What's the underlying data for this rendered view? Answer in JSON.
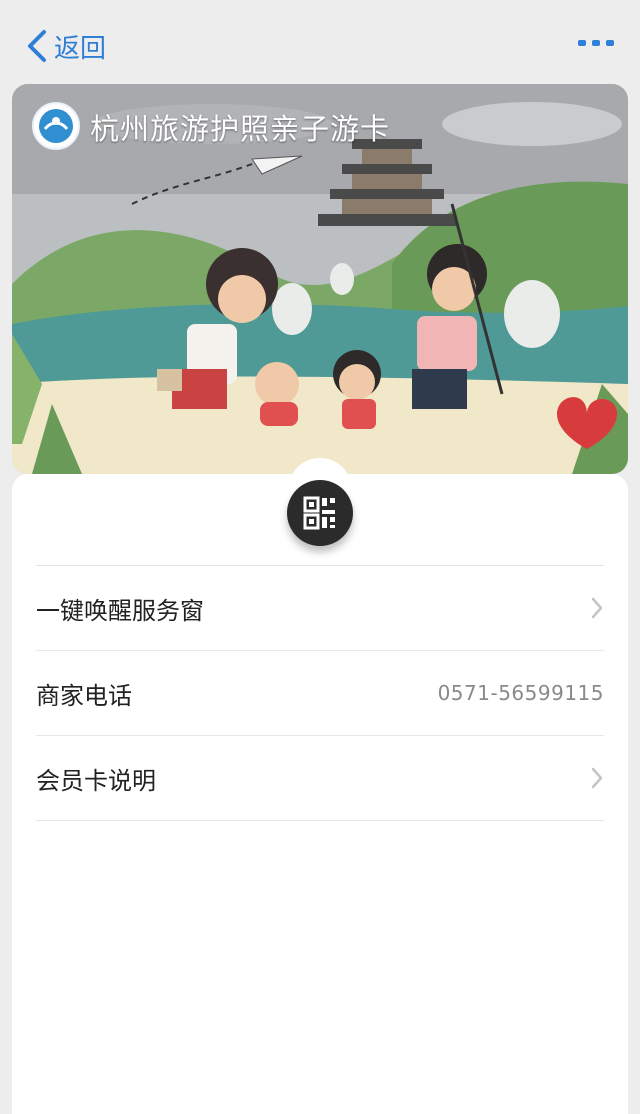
{
  "nav": {
    "back_label": "返回",
    "more_icon": "ellipsis-icon"
  },
  "card": {
    "title": "杭州旅游护照亲子游卡",
    "logo_icon": "hangzhou-tourism-logo"
  },
  "qr_icon": "qr-code-icon",
  "menu": [
    {
      "label": "一键唤醒服务窗",
      "value": "",
      "icon": "chevron-right-icon"
    },
    {
      "label": "商家电话",
      "value": "0571-56599115",
      "icon": ""
    },
    {
      "label": "会员卡说明",
      "value": "",
      "icon": "chevron-right-icon"
    }
  ],
  "colors": {
    "accent": "#2f7fd8",
    "background": "#ededed"
  }
}
